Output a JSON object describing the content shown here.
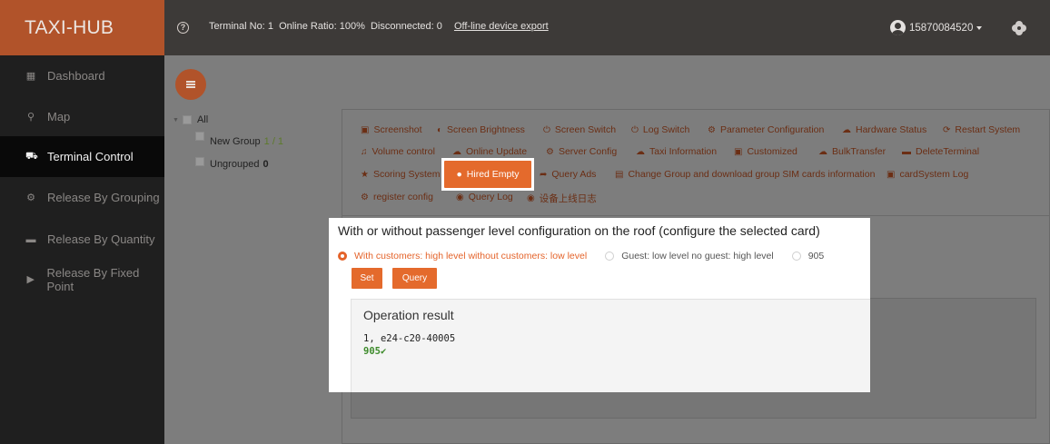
{
  "app": {
    "brand": "TAXI-HUB",
    "accent": "#e4632a"
  },
  "header": {
    "terminal_no_label": "Terminal No:",
    "terminal_no": "1",
    "online_ratio_label": "Online Ratio:",
    "online_ratio": "100%",
    "disconnected_label": "Disconnected:",
    "disconnected": "0",
    "export_link": "Off-line device export",
    "user": "15870084520"
  },
  "sidebar": {
    "items": [
      {
        "label": "Dashboard",
        "icon": "dashboard-icon"
      },
      {
        "label": "Map",
        "icon": "map-icon"
      },
      {
        "label": "Terminal Control",
        "icon": "car-icon",
        "active": true
      },
      {
        "label": "Release By Grouping",
        "icon": "group-icon"
      },
      {
        "label": "Release By Quantity",
        "icon": "card-icon"
      },
      {
        "label": "Release By Fixed Point",
        "icon": "play-icon"
      }
    ]
  },
  "tree": {
    "root": "All",
    "groups": [
      {
        "label": "New Group",
        "count": "1 / 1"
      },
      {
        "label": "Ungrouped",
        "count": "0"
      }
    ]
  },
  "commands": {
    "row1": [
      "Screenshot",
      "Screen Brightness",
      "Screen Switch",
      "Log Switch",
      "Parameter Configuration",
      "Hardware Status",
      "Restart System"
    ],
    "row2": [
      "Volume control",
      "Online Update",
      "Server Config",
      "Taxi Information",
      "Customized",
      "BulkTransfer",
      "DeleteTerminal"
    ],
    "row3": [
      "Scoring System",
      "Hired Empty",
      "Query Ads",
      "Change Group and download group SIM cards information",
      "cardSystem Log"
    ],
    "row4": [
      "register config",
      "Query Log",
      "设备上线日志"
    ]
  },
  "dialog": {
    "title": "With or without passenger level configuration on the roof (configure the selected card)",
    "options": [
      "With customers: high level without customers: low level",
      "Guest: low level no guest: high level",
      "905"
    ],
    "selected_option": 0,
    "set_button": "Set",
    "query_button": "Query",
    "result_title": "Operation result",
    "result_line": "1, e24-c20-40005",
    "result_ok": "905✔"
  }
}
